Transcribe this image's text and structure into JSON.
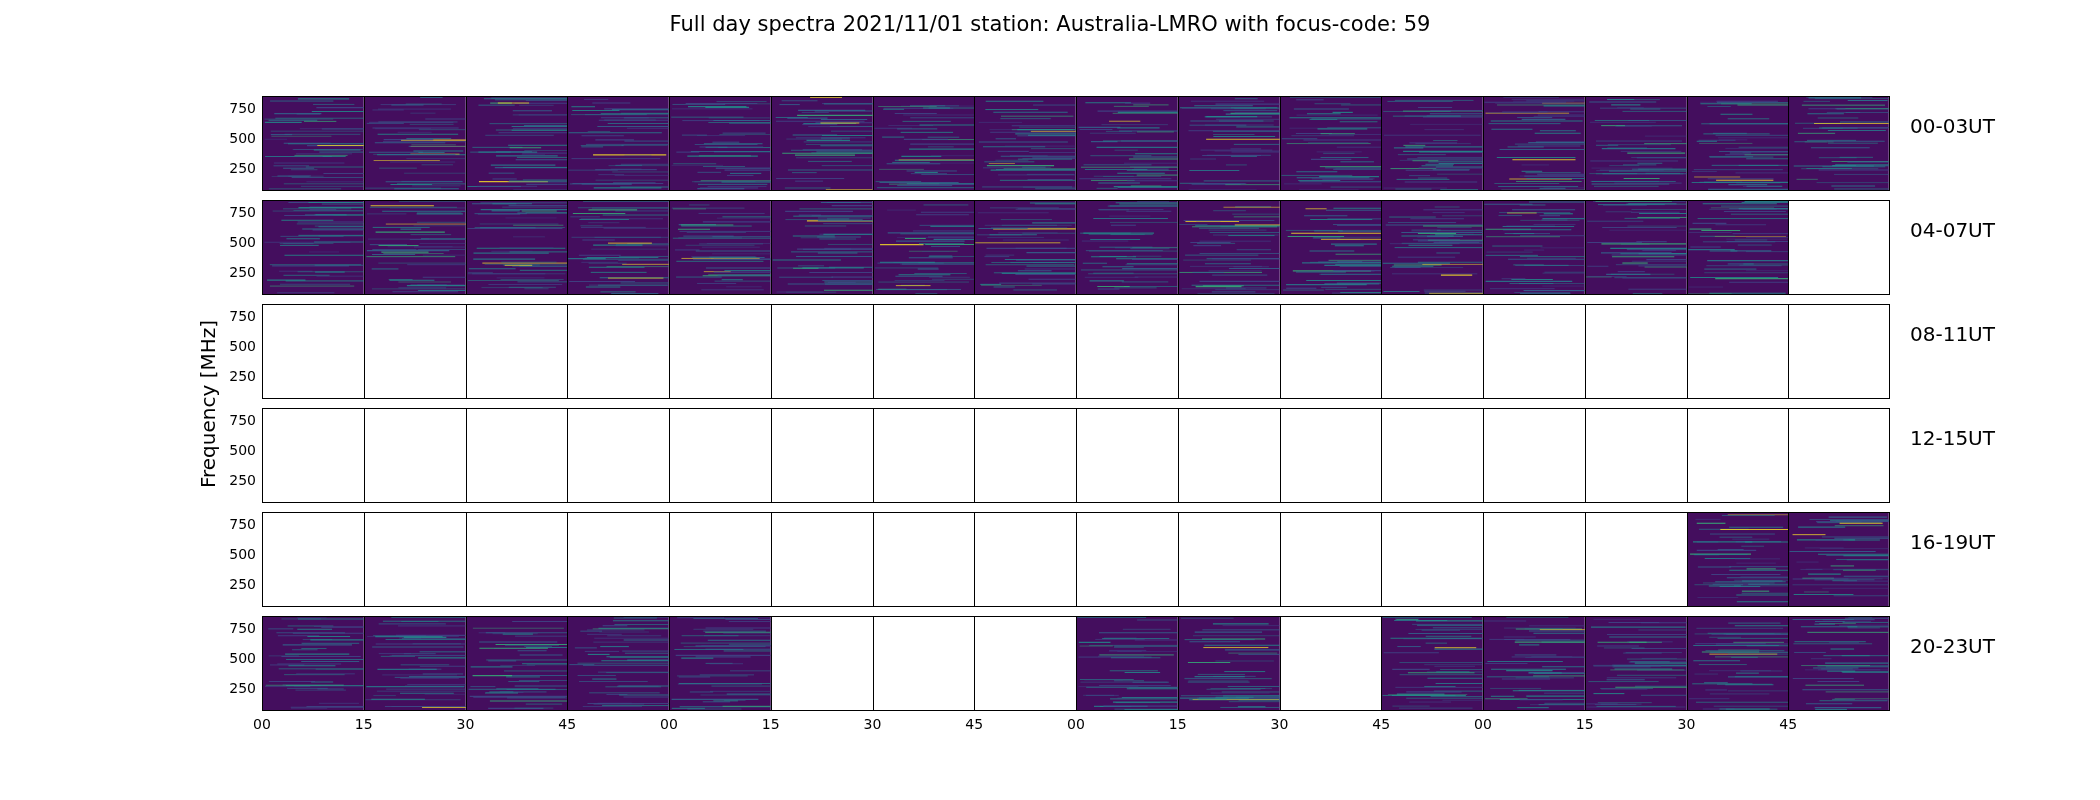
{
  "title": "Full day spectra 2021/11/01 station: Australia-LMRO with focus-code: 59",
  "ylabel": "Frequency [MHz]",
  "rows": [
    {
      "label": "00-03UT",
      "y_ticks": [
        "750",
        "500",
        "250"
      ],
      "cells": [
        {
          "filled": true
        },
        {
          "filled": true
        },
        {
          "filled": true
        },
        {
          "filled": true
        },
        {
          "filled": true
        },
        {
          "filled": true
        },
        {
          "filled": true
        },
        {
          "filled": true
        },
        {
          "filled": true
        },
        {
          "filled": true
        },
        {
          "filled": true
        },
        {
          "filled": true
        },
        {
          "filled": true
        },
        {
          "filled": true
        },
        {
          "filled": true
        },
        {
          "filled": true
        }
      ]
    },
    {
      "label": "04-07UT",
      "y_ticks": [
        "750",
        "500",
        "250"
      ],
      "cells": [
        {
          "filled": true
        },
        {
          "filled": true
        },
        {
          "filled": true
        },
        {
          "filled": true
        },
        {
          "filled": true
        },
        {
          "filled": true
        },
        {
          "filled": true
        },
        {
          "filled": true
        },
        {
          "filled": true
        },
        {
          "filled": true
        },
        {
          "filled": true
        },
        {
          "filled": true
        },
        {
          "filled": true
        },
        {
          "filled": true
        },
        {
          "filled": true
        },
        {
          "filled": false
        }
      ]
    },
    {
      "label": "08-11UT",
      "y_ticks": [
        "750",
        "500",
        "250"
      ],
      "cells": [
        {
          "filled": false
        },
        {
          "filled": false
        },
        {
          "filled": false
        },
        {
          "filled": false
        },
        {
          "filled": false
        },
        {
          "filled": false
        },
        {
          "filled": false
        },
        {
          "filled": false
        },
        {
          "filled": false
        },
        {
          "filled": false
        },
        {
          "filled": false
        },
        {
          "filled": false
        },
        {
          "filled": false
        },
        {
          "filled": false
        },
        {
          "filled": false
        },
        {
          "filled": false
        }
      ]
    },
    {
      "label": "12-15UT",
      "y_ticks": [
        "750",
        "500",
        "250"
      ],
      "cells": [
        {
          "filled": false
        },
        {
          "filled": false
        },
        {
          "filled": false
        },
        {
          "filled": false
        },
        {
          "filled": false
        },
        {
          "filled": false
        },
        {
          "filled": false
        },
        {
          "filled": false
        },
        {
          "filled": false
        },
        {
          "filled": false
        },
        {
          "filled": false
        },
        {
          "filled": false
        },
        {
          "filled": false
        },
        {
          "filled": false
        },
        {
          "filled": false
        },
        {
          "filled": false
        }
      ]
    },
    {
      "label": "16-19UT",
      "y_ticks": [
        "750",
        "500",
        "250"
      ],
      "cells": [
        {
          "filled": false
        },
        {
          "filled": false
        },
        {
          "filled": false
        },
        {
          "filled": false
        },
        {
          "filled": false
        },
        {
          "filled": false
        },
        {
          "filled": false
        },
        {
          "filled": false
        },
        {
          "filled": false
        },
        {
          "filled": false
        },
        {
          "filled": false
        },
        {
          "filled": false
        },
        {
          "filled": false
        },
        {
          "filled": false
        },
        {
          "filled": true
        },
        {
          "filled": true
        }
      ]
    },
    {
      "label": "20-23UT",
      "y_ticks": [
        "750",
        "500",
        "250"
      ],
      "cells": [
        {
          "filled": true
        },
        {
          "filled": true
        },
        {
          "filled": true
        },
        {
          "filled": true
        },
        {
          "filled": true
        },
        {
          "filled": false
        },
        {
          "filled": false
        },
        {
          "filled": false
        },
        {
          "filled": true
        },
        {
          "filled": true
        },
        {
          "filled": false
        },
        {
          "filled": true
        },
        {
          "filled": true
        },
        {
          "filled": true
        },
        {
          "filled": true
        },
        {
          "filled": true
        }
      ]
    }
  ],
  "x_ticks": [
    "00",
    "15",
    "30",
    "45",
    "00",
    "15",
    "30",
    "45",
    "00",
    "15",
    "30",
    "45",
    "00",
    "15",
    "30",
    "45"
  ]
}
